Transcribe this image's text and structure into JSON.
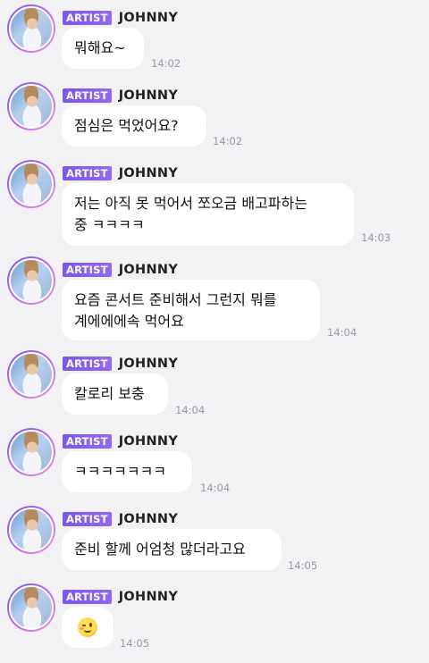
{
  "sender": {
    "badge": "ARTIST",
    "name": "JOHNNY"
  },
  "messages": [
    {
      "text": "뭐해요~",
      "time": "14:02"
    },
    {
      "text": "점심은 먹었어요?",
      "time": "14:02"
    },
    {
      "text": "저는 아직 못 먹어서 쪼오금 배고파하는\n중 ㅋㅋㅋㅋ",
      "time": "14:03"
    },
    {
      "text": "요즘 콘서트 준비해서 그런지 뭐를\n계에에에속 먹어요",
      "time": "14:04"
    },
    {
      "text": "칼로리 보충",
      "time": "14:04"
    },
    {
      "text": "ㅋㅋㅋㅋㅋㅋㅋ",
      "time": "14:04"
    },
    {
      "text": "준비 할께 어엄청 많더라고요",
      "time": "14:05"
    },
    {
      "emoji": "winking-face",
      "time": "14:05"
    }
  ],
  "colors": {
    "background": "#f2f2f4",
    "badge": "#7b57ea",
    "bubble": "#ffffff",
    "timestamp": "#9b9ba3"
  }
}
